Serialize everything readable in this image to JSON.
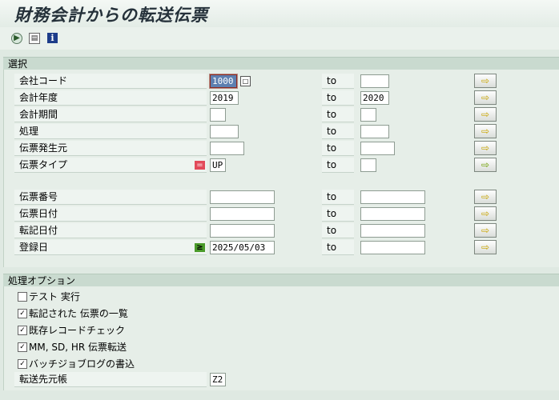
{
  "title": "財務会計からの転送伝票",
  "toolbar": {
    "execute_icon": "execute-icon",
    "variant_icon": "get-variant-icon",
    "info_icon_glyph": "i"
  },
  "selection": {
    "header": "選択",
    "to_label": "to",
    "rows": [
      {
        "label": "会社コード",
        "from": "1000",
        "to": ""
      },
      {
        "label": "会計年度",
        "from": "2019",
        "to": "2020"
      },
      {
        "label": "会計期間",
        "from": "",
        "to": ""
      },
      {
        "label": "処理",
        "from": "",
        "to": ""
      },
      {
        "label": "伝票発生元",
        "from": "",
        "to": ""
      },
      {
        "label": "伝票タイプ",
        "from": "UP",
        "to": ""
      },
      {
        "label": "伝票番号",
        "from": "",
        "to": ""
      },
      {
        "label": "伝票日付",
        "from": "",
        "to": ""
      },
      {
        "label": "転記日付",
        "from": "",
        "to": ""
      },
      {
        "label": "登録日",
        "from": "2025/05/03",
        "to": ""
      }
    ],
    "arrow_glyph": "⇨",
    "sel_eq_glyph": "=",
    "sel_ge_glyph": "≥"
  },
  "options": {
    "header": "処理オプション",
    "checks": [
      {
        "label": "テスト 実行",
        "checked": false
      },
      {
        "label": "転記された 伝票の一覧",
        "checked": true
      },
      {
        "label": "既存レコードチェック",
        "checked": true
      },
      {
        "label": "MM, SD, HR 伝票転送",
        "checked": true
      },
      {
        "label": "バッチジョブログの書込",
        "checked": true
      }
    ],
    "target_ledger_label": "転送先元帳",
    "target_ledger_value": "Z2"
  }
}
